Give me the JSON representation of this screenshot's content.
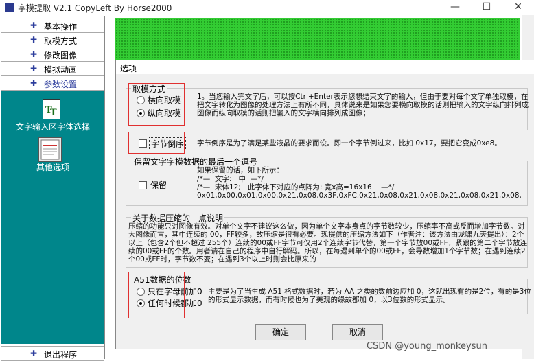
{
  "window": {
    "title": "字模提取 V2.1  CopyLeft By Horse2000",
    "min_glyph": "—",
    "max_glyph": "☐",
    "close_glyph": "✕"
  },
  "menu": {
    "items": [
      {
        "label": "基本操作"
      },
      {
        "label": "取模方式"
      },
      {
        "label": "修改图像"
      },
      {
        "label": "模拟动画"
      },
      {
        "label": "参数设置"
      }
    ],
    "exit_label": "退出程序",
    "tool1_label": "文字输入区字体选择",
    "tool2_label": "其他选项"
  },
  "dialog": {
    "title": "选项",
    "mode_group": {
      "legend": "取模方式",
      "opt1": "横向取模",
      "opt2": "纵向取模",
      "text": "1。当您输入完文字后，可以按Ctrl+Enter表示您想结束文字的输入，但由于要对每个文字单独取模，在把文字转化为图像的处理方法上有所不同，具体说来是如果您要横向取模的话则把输入的文字纵向排列成图像而纵向取模的话则把输入的文字横向排列成图像；"
    },
    "reverse": {
      "label": "字节倒序",
      "text": "字节倒序是为了满足某些液晶的要求而设。即一个字节倒过来，比如 0x17，要把它变成0xe8。"
    },
    "keep_comma": {
      "legend": "保留文字字模数据的最后一个逗号",
      "label": "保留",
      "line1": "如果保留的话，如下所示：",
      "line2": "/*—  文字:   中  —*/",
      "line3": "/*—  宋体12;   此字体下对应的点阵为: 宽x高=16x16    —*/",
      "line4": "0x01,0x00,0x01,0x00,0x21,0x08,0x3F,0xFC,0x21,0x08,0x21,0x08,0x21,0x08,0x21,0x08,"
    },
    "compress": {
      "legend": "关于数据压缩的一点说明",
      "text": "压缩的功能只对图像有效。对单个文字不建议这么做，因为单个文字本身点的字节数较少，压缩率不高或反而增加字节数。对大图像而言，其中连续的 00，FF较多，故压缩是很有必要。现提供的压缩方法如下（作者注：该方法由龙啸九天提出）：2个以上（包含2个但不超过 255个）连续的00或FF字节可仅用2个连续字节代替，第一个字节放00或FF，紧跟的第二个字节放连续的00或FF的个数。用者请在自己的程序中自行解码。所以，在每遇到单个的00或FF，会导数增加1个字节数；在遇到连续2个00或FF时，字节数不变；在遇到3个以上时则会比原来的"
    },
    "a51": {
      "legend": "A51数据的位数",
      "opt1": "只在字母前加0",
      "opt2": "任何时候都加0",
      "text": "主要是为了当生成 A51 格式数据时，若为 AA 之类的数前边应加 0，这就出现有的是2位，有的是3位的形式显示数据，而有时候也为了美观的缘故都加 0，以3位数的形式显示。"
    },
    "ok": "确定",
    "cancel": "取消"
  },
  "watermark": "CSDN @young_monkeysun"
}
